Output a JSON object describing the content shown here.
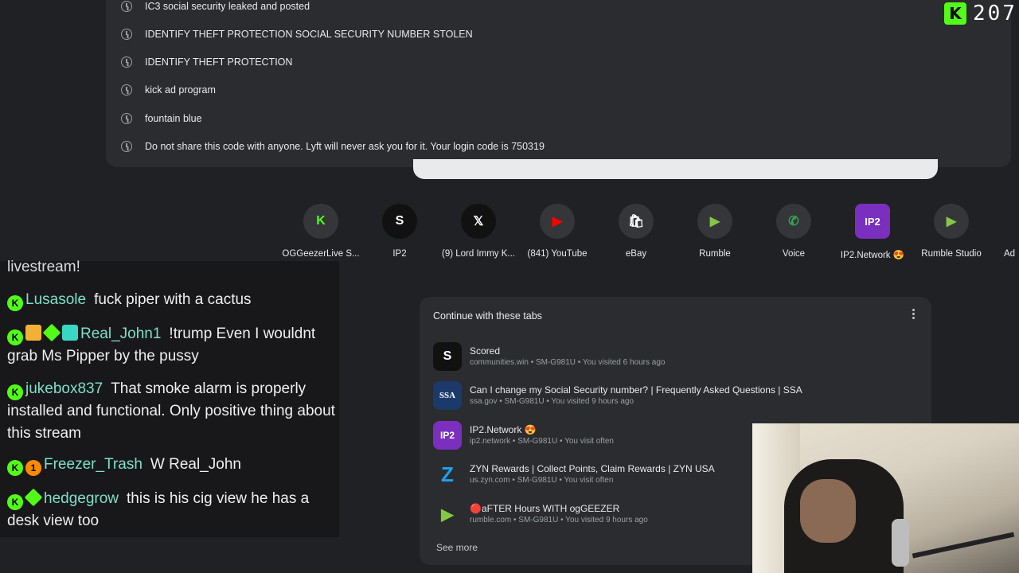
{
  "history": [
    {
      "text": "IC3 social security leaked and posted"
    },
    {
      "text": "IDENTIFY THEFT PROTECTION SOCIAL SECURITY NUMBER STOLEN"
    },
    {
      "text": "IDENTIFY THEFT PROTECTION"
    },
    {
      "text": "kick ad program"
    },
    {
      "text": "fountain blue"
    },
    {
      "text": "Do not share this code with anyone. Lyft will never ask you for it. Your login code is 750319"
    }
  ],
  "stream_counter": {
    "logo": "K",
    "value": "207"
  },
  "shortcuts": [
    {
      "icon": "K",
      "label": "OGGeezerLive S...",
      "bg": "#35363a",
      "color": "#53fc18"
    },
    {
      "icon": "S",
      "label": "IP2",
      "bg": "#111111",
      "color": "#ffffff"
    },
    {
      "icon": "𝕏",
      "label": "(9) Lord Immy K...",
      "bg": "#111111",
      "color": "#ffffff"
    },
    {
      "icon": "▶",
      "label": "(841) YouTube",
      "bg": "#35363a",
      "color": "#ff0000"
    },
    {
      "icon": "🛍",
      "label": "eBay",
      "bg": "#35363a",
      "color": "#ffffff"
    },
    {
      "icon": "▶",
      "label": "Rumble",
      "bg": "#35363a",
      "color": "#85c742"
    },
    {
      "icon": "✆",
      "label": "Voice",
      "bg": "#35363a",
      "color": "#34a853"
    },
    {
      "icon": "IP2",
      "label": "IP2.Network 😍",
      "bg": "#7b2fbe",
      "color": "#ffffff"
    },
    {
      "icon": "▶",
      "label": "Rumble Studio",
      "bg": "#35363a",
      "color": "#85c742"
    },
    {
      "icon": "",
      "label": "Ad",
      "bg": "#35363a",
      "color": "#ffffff"
    }
  ],
  "chat": {
    "partial_top": "livestream!",
    "messages": [
      {
        "user": "Lusasole",
        "text": "fuck piper with a cactus",
        "color": "#7ee0c8"
      },
      {
        "user": "Real_John1",
        "text": "!trump Even I wouldnt grab Ms Pipper by the pussy",
        "color": "#7ee0c8"
      },
      {
        "user": "jukebox837",
        "text": "That smoke alarm is properly installed and functional. Only positive thing about this stream",
        "color": "#7ee0c8"
      },
      {
        "user": "Freezer_Trash",
        "text": "W Real_John",
        "color": "#7ee0c8"
      },
      {
        "user": "hedgegrow",
        "text": "this is his cig view he has a desk view too",
        "color": "#7ee0c8"
      }
    ]
  },
  "tabs_card": {
    "title": "Continue with these tabs",
    "see_more": "See more",
    "tabs": [
      {
        "icon": "S",
        "icon_bg": "#111111",
        "icon_color": "#ffffff",
        "title": "Scored",
        "sub": "communities.win • SM-G981U • You visited 6 hours ago"
      },
      {
        "icon": "SSA",
        "icon_bg": "#1b3a6b",
        "icon_color": "#ffffff",
        "title": "Can I change my Social Security number? | Frequently Asked Questions | SSA",
        "sub": "ssa.gov • SM-G981U • You visited 9 hours ago"
      },
      {
        "icon": "IP2",
        "icon_bg": "#7b2fbe",
        "icon_color": "#ffffff",
        "title": "IP2.Network 😍",
        "sub": "ip2.network • SM-G981U • You visit often"
      },
      {
        "icon": "Z",
        "icon_bg": "#2b2c2f",
        "icon_color": "#1da1f2",
        "title": "ZYN Rewards | Collect Points, Claim Rewards | ZYN USA",
        "sub": "us.zyn.com • SM-G981U • You visit often"
      },
      {
        "icon": "▶",
        "icon_bg": "#2b2c2f",
        "icon_color": "#85c742",
        "title": "🔴aFTER Hours WITH ogGEEZER",
        "sub": "rumble.com • SM-G981U • You visited 9 hours ago"
      }
    ]
  }
}
